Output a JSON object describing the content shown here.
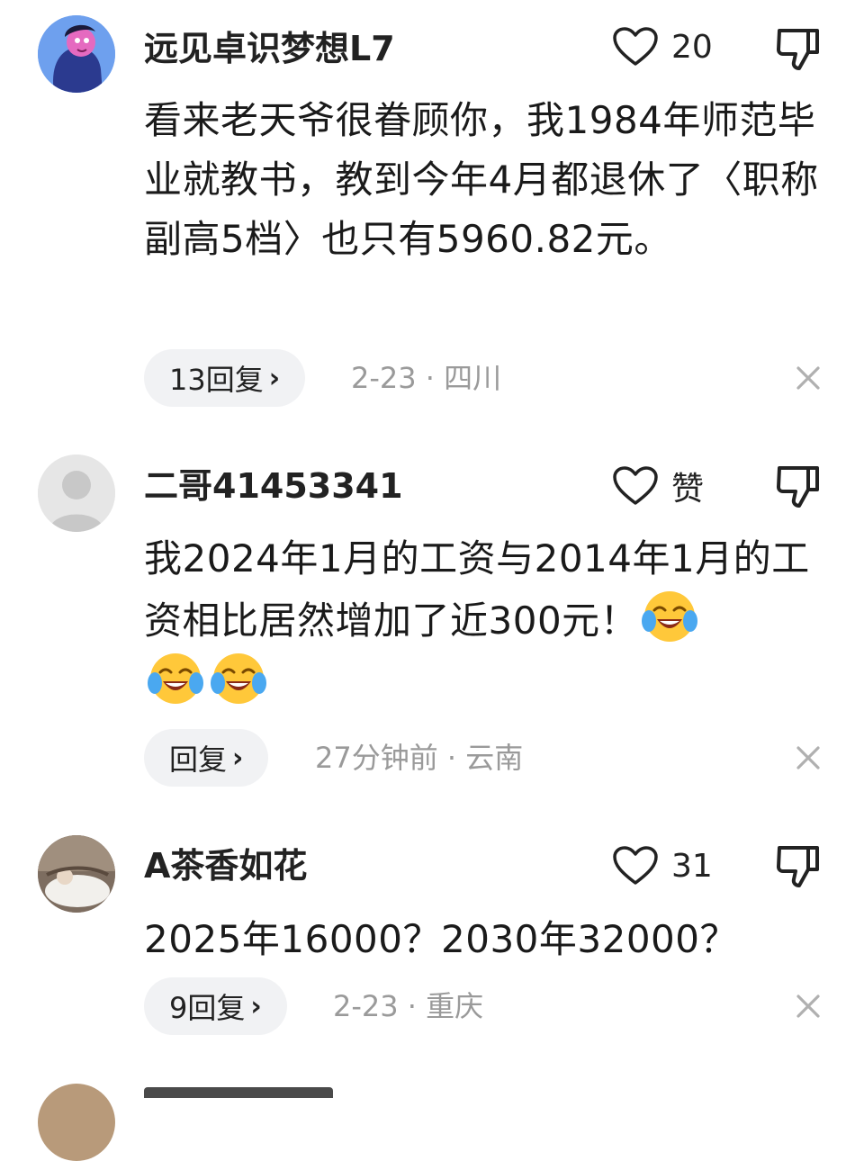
{
  "comments": [
    {
      "username": "远见卓识梦想L7",
      "likes": "20",
      "text": "看来老天爷很眷顾你，我1984年师范毕业就教书，教到今年4月都退休了〈职称副高5档〉也只有5960.82元。",
      "reply_label": "13回复",
      "meta": "2-23 · 四川"
    },
    {
      "username": "二哥41453341",
      "likes": "赞",
      "text": "我2024年1月的工资与2014年1月的工资相比居然增加了近300元！",
      "emojis": [
        "laugh-cry-emoji",
        "laugh-cry-emoji",
        "laugh-cry-emoji"
      ],
      "reply_label": "回复",
      "meta": "27分钟前 · 云南"
    },
    {
      "username": "A茶香如花",
      "likes": "31",
      "text": "2025年16000？2030年32000？",
      "reply_label": "9回复",
      "meta": "2-23 · 重庆"
    }
  ],
  "icons": {
    "like": "heart-outline-icon",
    "dislike": "thumbs-down-icon",
    "close": "close-icon",
    "chevron": "chevron-right-icon"
  },
  "colors": {
    "pill_bg": "#f1f2f4",
    "meta_text": "#9a9a9a",
    "avatar1_bg": "#6ea0ee",
    "avatar2_bg": "#e6e6e6"
  },
  "chevron_glyph": "›"
}
